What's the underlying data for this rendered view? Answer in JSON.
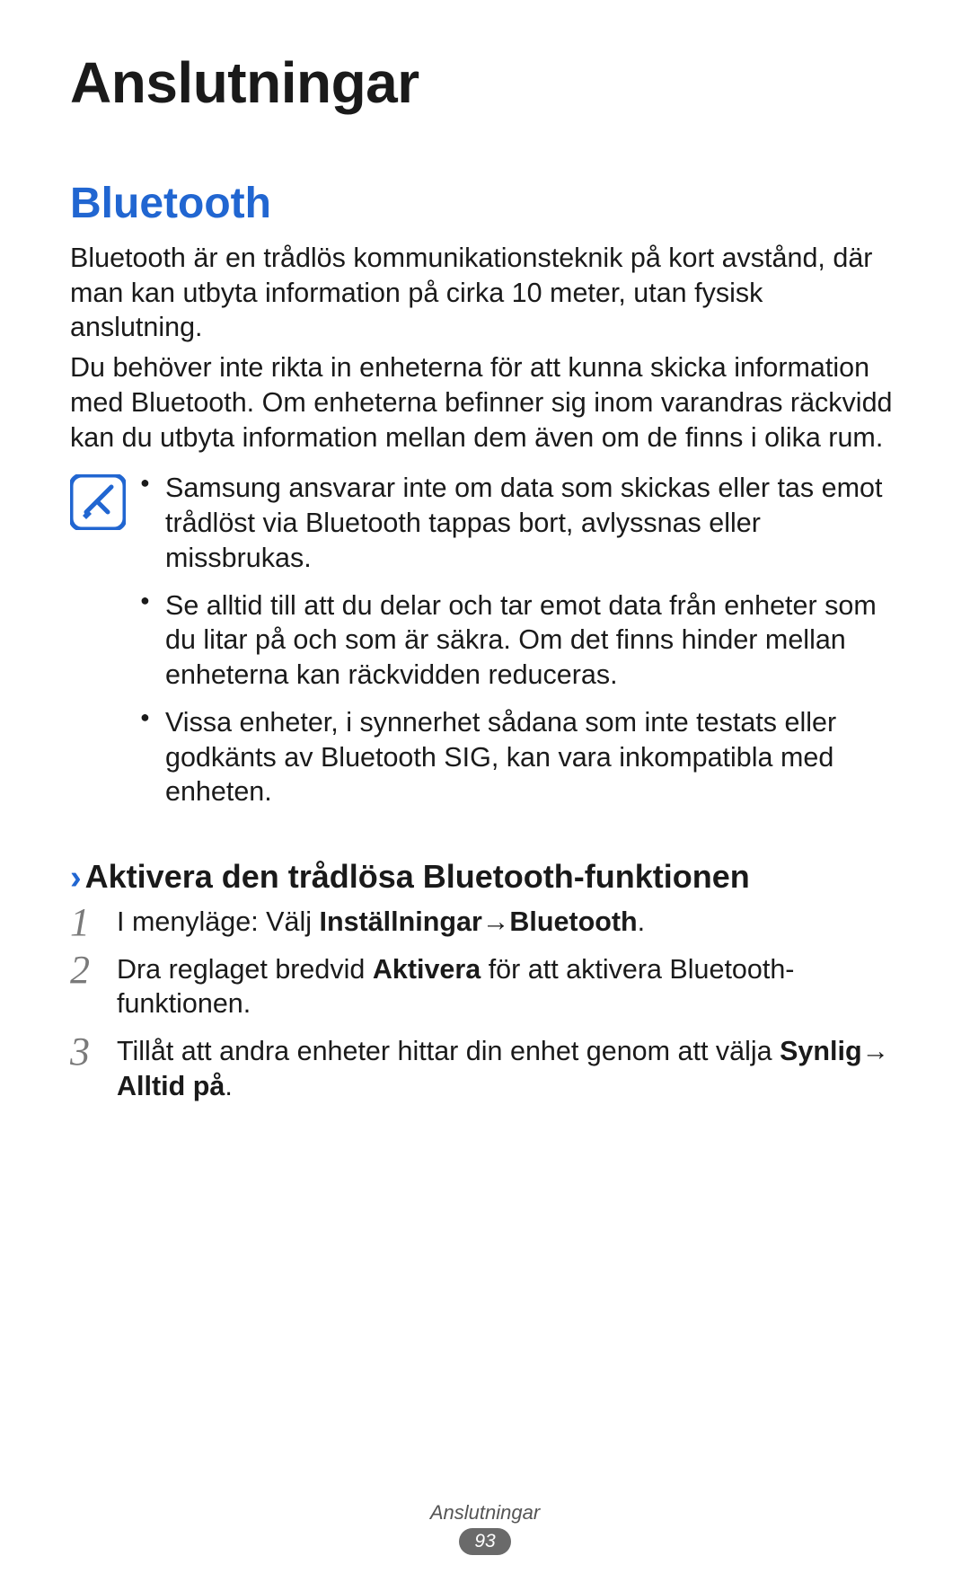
{
  "chapter_title": "Anslutningar",
  "section": {
    "title": "Bluetooth",
    "para1": "Bluetooth är en trådlös kommunikationsteknik på kort avstånd, där man kan utbyta information på cirka 10 meter, utan fysisk anslutning.",
    "para2": "Du behöver inte rikta in enheterna för att kunna skicka information med Bluetooth. Om enheterna befinner sig inom varandras räckvidd kan du utbyta information mellan dem även om de finns i olika rum."
  },
  "note": {
    "icon_name": "note-icon",
    "items": [
      "Samsung ansvarar inte om data som skickas eller tas emot trådlöst via Bluetooth tappas bort, avlyssnas eller missbrukas.",
      "Se alltid till att du delar och tar emot data från enheter som du litar på och som är säkra. Om det finns hinder mellan enheterna kan räckvidden reduceras.",
      "Vissa enheter, i synnerhet sådana som inte testats eller godkänts av Bluetooth SIG, kan vara inkompatibla med enheten."
    ]
  },
  "subsection": {
    "chevron": "›",
    "title": "Aktivera den trådlösa Bluetooth-funktionen",
    "steps": [
      {
        "num": "1",
        "pre": "I menyläge: Välj ",
        "bold1": "Inställningar",
        "arrow": " → ",
        "bold2": "Bluetooth",
        "post": "."
      },
      {
        "num": "2",
        "pre": "Dra reglaget bredvid ",
        "bold1": "Aktivera",
        "post": " för att aktivera Bluetooth-funktionen."
      },
      {
        "num": "3",
        "pre": "Tillåt att andra enheter hittar din enhet genom att välja ",
        "bold1": "Synlig",
        "arrow": " → ",
        "bold2": "Alltid på",
        "post": "."
      }
    ]
  },
  "footer": {
    "label": "Anslutningar",
    "page": "93"
  }
}
